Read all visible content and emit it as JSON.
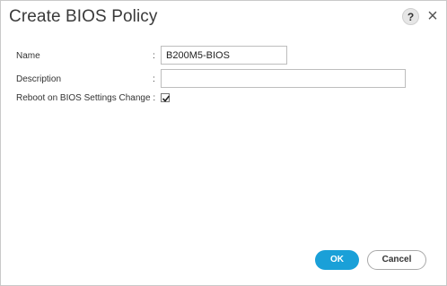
{
  "dialog": {
    "title": "Create BIOS Policy",
    "help_icon_glyph": "?",
    "close_icon_glyph": "×",
    "icons": [
      "help-icon",
      "close-icon"
    ]
  },
  "form": {
    "name": {
      "label": "Name",
      "colon": ":",
      "value": "B200M5-BIOS"
    },
    "description": {
      "label": "Description",
      "colon": ":",
      "value": ""
    },
    "reboot": {
      "label": "Reboot on BIOS Settings Change :",
      "checked": true
    }
  },
  "buttons": {
    "ok_label": "OK",
    "cancel_label": "Cancel"
  },
  "colors": {
    "accent": "#1aa0d8",
    "title_text": "#3a3a3a",
    "border": "#c9c9c9"
  }
}
